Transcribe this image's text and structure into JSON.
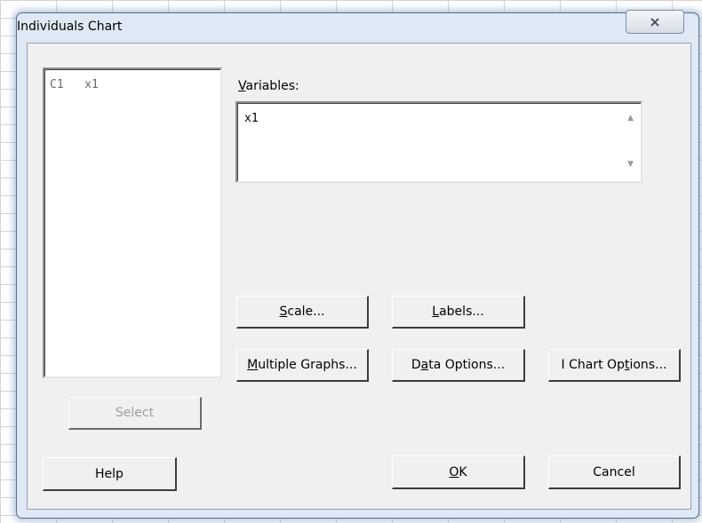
{
  "dialog": {
    "title": "Individuals Chart",
    "close_icon": "close-x-icon"
  },
  "columns_list": {
    "items": [
      {
        "col": "C1",
        "name": "x1"
      }
    ]
  },
  "variables": {
    "label_mnemonic": "V",
    "label_rest": "ariables:",
    "value": "x1"
  },
  "buttons": {
    "scale": {
      "mn": "S",
      "rest": "cale..."
    },
    "labels": {
      "mn": "L",
      "rest": "abels..."
    },
    "multiple_graphs": {
      "mn": "M",
      "rest": "ultiple Graphs..."
    },
    "data_options": {
      "pre": "D",
      "mn": "a",
      "rest": "ta Options..."
    },
    "ichart_options": {
      "pre": "I Chart Op",
      "mn": "t",
      "rest": "ions..."
    },
    "select": "Select",
    "help": "Help",
    "ok": {
      "mn": "O",
      "rest": "K"
    },
    "cancel": "Cancel"
  }
}
